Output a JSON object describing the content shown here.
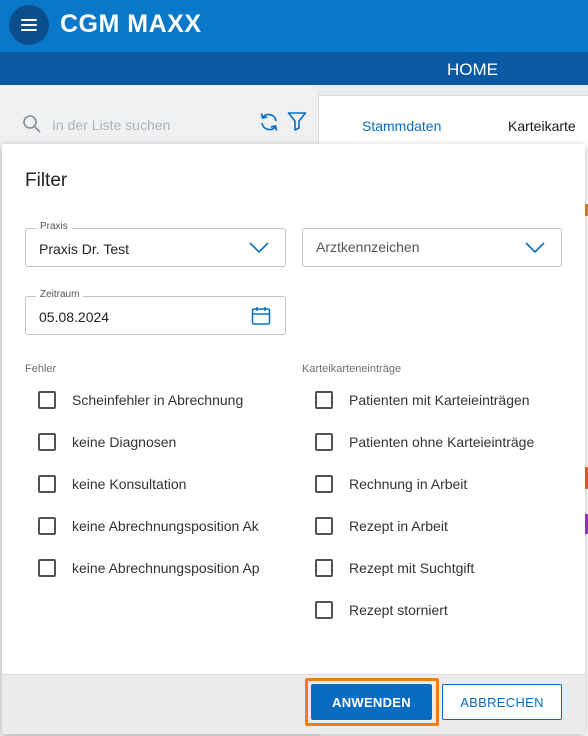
{
  "app": {
    "title": "CGM MAXX",
    "section": "HOME"
  },
  "icons": {
    "menu": "hamburger-icon",
    "search": "search-icon",
    "refresh": "refresh-icon",
    "filter": "filter-icon",
    "chevron": "chevron-down-icon",
    "calendar": "calendar-icon"
  },
  "colors": {
    "primary": "#0a78c8",
    "dark_primary": "#0a5aa3",
    "highlight": "#f07c14"
  },
  "list": {
    "search_placeholder": "In der Liste suchen"
  },
  "tabs": [
    "Stammdaten",
    "Karteikarte"
  ],
  "filter": {
    "title": "Filter",
    "praxis": {
      "label": "Praxis",
      "value": "Praxis Dr. Test"
    },
    "arzt": {
      "placeholder": "Arztkennzeichen"
    },
    "zeitraum": {
      "label": "Zeitraum",
      "value": "05.08.2024"
    },
    "fehler": {
      "label": "Fehler",
      "items": [
        "Scheinfehler in Abrechnung",
        "keine Diagnosen",
        "keine Konsultation",
        "keine Abrechnungsposition Ak",
        "keine Abrechnungsposition Ap"
      ]
    },
    "kartei": {
      "label": "Karteikarteneinträge",
      "items": [
        "Patienten mit Karteieinträgen",
        "Patienten ohne Karteieinträge",
        "Rechnung in Arbeit",
        "Rezept in Arbeit",
        "Rezept mit Suchtgift",
        "Rezept storniert"
      ]
    },
    "buttons": {
      "apply": "ANWENDEN",
      "cancel": "ABBRECHEN"
    }
  }
}
